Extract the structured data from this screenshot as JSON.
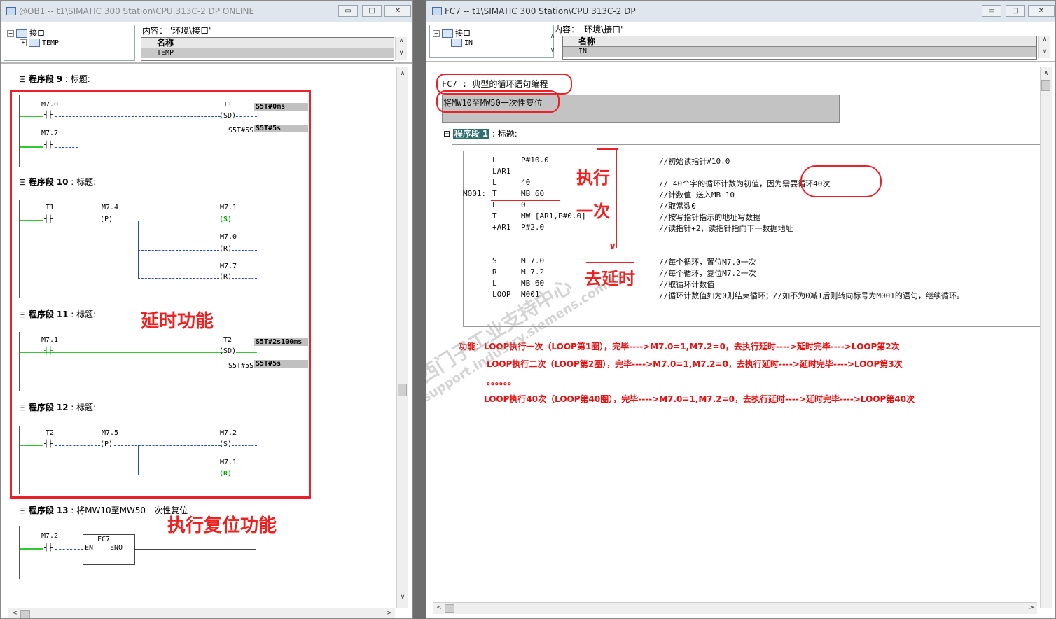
{
  "left_window": {
    "title": "@OB1 -- t1\\SIMATIC 300 Station\\CPU 313C-2 DP  ONLINE",
    "controls": [
      "▭",
      "□",
      "✕"
    ],
    "tree": {
      "root": "接口",
      "child": "TEMP"
    },
    "content_label": "内容： '环境\\接口'",
    "grid_header": "名称",
    "grid_row": "TEMP"
  },
  "right_window": {
    "title": "FC7 -- t1\\SIMATIC 300 Station\\CPU 313C-2 DP",
    "controls": [
      "▭",
      "□",
      "✕"
    ],
    "tree": {
      "root": "接口",
      "child": "IN"
    },
    "content_label": "内容： '环境\\接口'",
    "grid_header": "名称",
    "grid_row": "IN"
  },
  "segments_left": [
    {
      "label": "程序段",
      "num": "9",
      "title": "标题:"
    },
    {
      "label": "程序段",
      "num": "10",
      "title": "标题:"
    },
    {
      "label": "程序段",
      "num": "11",
      "title": "标题:"
    },
    {
      "label": "程序段",
      "num": "12",
      "title": "标题:"
    },
    {
      "label": "程序段",
      "num": "13",
      "title": "将MW10至MW50一次性复位"
    }
  ],
  "ladder": {
    "seg9": {
      "c1": "M7.0",
      "c2": "M7.7",
      "coil": "T1",
      "coil_type": "(SD)",
      "preset": "S5T#0ms",
      "tv": "S5T#5S",
      "tv_val": "S5T#5s"
    },
    "seg10": {
      "c1": "T1",
      "c2": "M7.4",
      "p": "(P)",
      "o1": "M7.1",
      "o1t": "(S)",
      "o2": "M7.0",
      "o2t": "(R)",
      "o3": "M7.7",
      "o3t": "(R)"
    },
    "seg11": {
      "c1": "M7.1",
      "coil": "T2",
      "coil_type": "(SD)",
      "preset": "S5T#2s100ms",
      "tv": "S5T#5S",
      "tv_val": "S5T#5s"
    },
    "seg12": {
      "c1": "T2",
      "c2": "M7.5",
      "p": "(P)",
      "o1": "M7.2",
      "o1t": "(S)",
      "o2": "M7.1",
      "o2t": "(R)"
    },
    "seg13": {
      "c1": "M7.2",
      "block": "FC7",
      "en": "EN",
      "eno": "ENO"
    }
  },
  "annotations_left": {
    "delay": "延时功能",
    "reset": "执行复位功能"
  },
  "fc7": {
    "header": "FC7 : 典型的循环语句编程",
    "comment": "将MW10至MW50一次性复位",
    "seg_label": "程序段",
    "seg_num": "1",
    "seg_title": "标题:",
    "code": [
      {
        "label": "",
        "op": "L",
        "arg": "P#10.0",
        "cmt": "//初始读指针#10.0"
      },
      {
        "label": "",
        "op": "LAR1",
        "arg": "",
        "cmt": ""
      },
      {
        "label": "",
        "op": "L",
        "arg": "40",
        "cmt": "// 40个字的循环计数为初值，因为需要循环40次"
      },
      {
        "label": "M001:",
        "op": "T",
        "arg": "MB    60",
        "cmt": "//计数值 送入MB 10"
      },
      {
        "label": "",
        "op": "L",
        "arg": "0",
        "cmt": "//取常数0"
      },
      {
        "label": "",
        "op": "T",
        "arg": "MW [AR1,P#0.0]",
        "cmt": "//按写指针指示的地址写数据"
      },
      {
        "label": "",
        "op": "+AR1",
        "arg": "P#2.0",
        "cmt": "//读指针+2，读指针指向下一数据地址"
      },
      {
        "label": "",
        "op": "S",
        "arg": "M     7.0",
        "cmt": "//每个循环，置位M7.0一次"
      },
      {
        "label": "",
        "op": "R",
        "arg": "M     7.2",
        "cmt": "//每个循环，复位M7.2一次"
      },
      {
        "label": "",
        "op": "L",
        "arg": "MB   60",
        "cmt": "//取循环计数值"
      },
      {
        "label": "",
        "op": "LOOP",
        "arg": "M001",
        "cmt": "//循环计数值如为0则结束循环；//如不为0减1后则转向标号为M001的语句，继续循环。"
      }
    ],
    "annotations": {
      "exec": "执行",
      "once": "一次",
      "godelay": "去延时"
    },
    "notes": [
      "功能：LOOP执行一次（LOOP第1圈），完毕---->M7.0=1,M7.2=0，去执行延时---->延时完毕---->LOOP第2次",
      "LOOP执行二次（LOOP第2圈），完毕---->M7.0=1,M7.2=0，去执行延时---->延时完毕---->LOOP第3次",
      "。。。。。。",
      "LOOP执行40次（LOOP第40圈），完毕---->M7.0=1,M7.2=0，去执行延时---->延时完毕---->LOOP第40次"
    ]
  },
  "watermark": {
    "line1": "西门子工业支持中心",
    "line2": "support.industry.siemens.com/cs"
  }
}
